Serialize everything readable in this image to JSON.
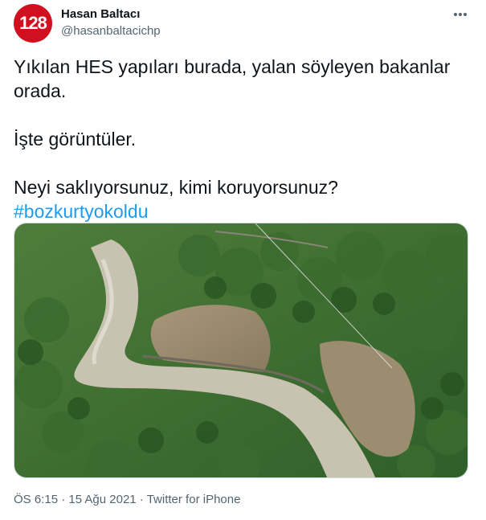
{
  "author": {
    "avatar_text": "128",
    "avatar_color": "#d0101f",
    "name": "Hasan Baltacı",
    "handle": "@hasanbaltacichp"
  },
  "tweet": {
    "line1": "Yıkılan HES yapıları burada, yalan söyleyen bakanlar orada.",
    "line2": "İşte görüntüler.",
    "line3": "Neyi saklıyorsunuz, kimi koruyorsunuz?",
    "hashtag": "#bozkurtyokoldu",
    "hashtag_color": "#1d9bf0"
  },
  "media": {
    "icon": "aerial-landslide-photo"
  },
  "meta": {
    "time": "ÖS 6:15",
    "sep1": " · ",
    "date": "15 Ağu 2021",
    "sep2": " · ",
    "source": "Twitter for iPhone"
  },
  "icons": {
    "more": "more-dots-icon"
  }
}
